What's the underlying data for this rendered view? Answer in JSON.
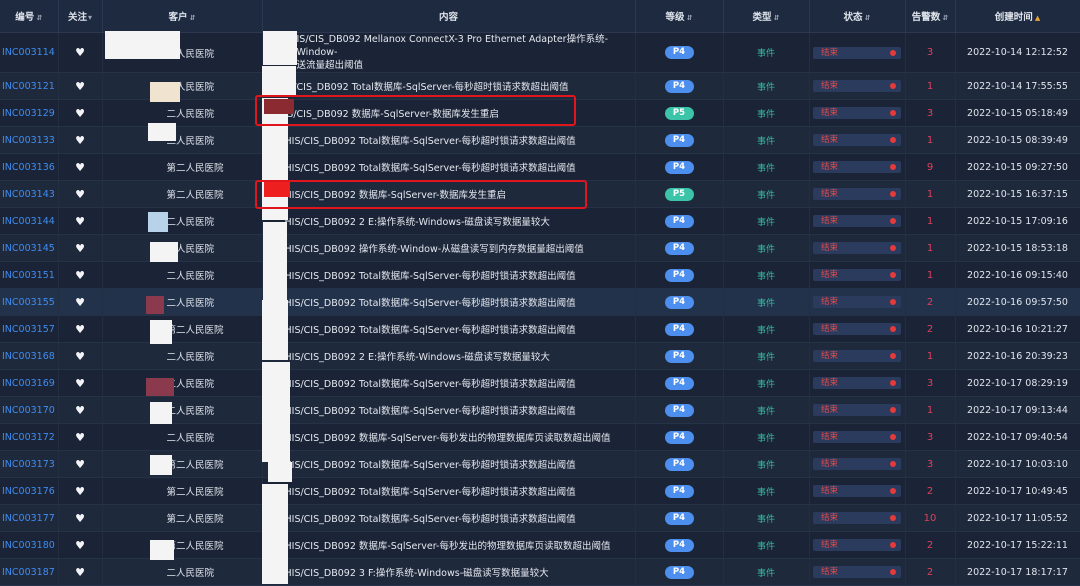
{
  "headers": {
    "code": "编号",
    "follow": "关注",
    "customer": "客户",
    "content": "内容",
    "level": "等级",
    "type": "类型",
    "status": "状态",
    "count": "告警数",
    "created": "创建时间"
  },
  "sort_icon": "⇵",
  "sort_asc_icon": "▲",
  "filter_icon": "▾",
  "heart_icon": "♥",
  "colors": {
    "P4": "#4d8fef",
    "P5": "#3cc4a9",
    "status_red": "#e24a4a",
    "code_blue": "#3f8cf0"
  },
  "rows": [
    {
      "code": "INC003114",
      "customer": "二人民医院",
      "content": "IS/CIS_DB092 Mellanox ConnectX-3 Pro Ethernet Adapter操作系统-Window-",
      "content2": "送流量超出阈值",
      "level": "P4",
      "type": "事件",
      "status": "结束",
      "count": "3",
      "time": "2022-10-14 12:12:52"
    },
    {
      "code": "INC003121",
      "customer": "二人民医院",
      "content": "IS/CIS_DB092 Total数据库-SqlServer-每秒超时锁请求数超出阈值",
      "level": "P4",
      "type": "事件",
      "status": "结束",
      "count": "1",
      "time": "2022-10-14 17:55:55"
    },
    {
      "code": "INC003129",
      "customer": "二人民医院",
      "content": "IS/CIS_DB092 数据库-SqlServer-数据库发生重启",
      "level": "P5",
      "type": "事件",
      "status": "结束",
      "count": "3",
      "time": "2022-10-15 05:18:49"
    },
    {
      "code": "INC003133",
      "customer": "二人民医院",
      "content": "HIS/CIS_DB092 Total数据库-SqlServer-每秒超时锁请求数超出阈值",
      "level": "P4",
      "type": "事件",
      "status": "结束",
      "count": "1",
      "time": "2022-10-15 08:39:49"
    },
    {
      "code": "INC003136",
      "customer": "第二人民医院",
      "content": "HIS/CIS_DB092 Total数据库-SqlServer-每秒超时锁请求数超出阈值",
      "level": "P4",
      "type": "事件",
      "status": "结束",
      "count": "9",
      "time": "2022-10-15 09:27:50"
    },
    {
      "code": "INC003143",
      "customer": "第二人民医院",
      "content": "HIS/CIS_DB092 数据库-SqlServer-数据库发生重启",
      "level": "P5",
      "type": "事件",
      "status": "结束",
      "count": "1",
      "time": "2022-10-15 16:37:15"
    },
    {
      "code": "INC003144",
      "customer": "二人民医院",
      "content": "HIS/CIS_DB092 2 E:操作系统-Windows-磁盘读写数据量较大",
      "level": "P4",
      "type": "事件",
      "status": "结束",
      "count": "1",
      "time": "2022-10-15 17:09:16"
    },
    {
      "code": "INC003145",
      "customer": "二人民医院",
      "content": "HIS/CIS_DB092 操作系统-Window-从磁盘读写到内存数据量超出阈值",
      "level": "P4",
      "type": "事件",
      "status": "结束",
      "count": "1",
      "time": "2022-10-15 18:53:18"
    },
    {
      "code": "INC003151",
      "customer": "二人民医院",
      "content": "HIS/CIS_DB092 Total数据库-SqlServer-每秒超时锁请求数超出阈值",
      "level": "P4",
      "type": "事件",
      "status": "结束",
      "count": "1",
      "time": "2022-10-16 09:15:40"
    },
    {
      "code": "INC003155",
      "customer": "二人民医院",
      "content": "HIS/CIS_DB092 Total数据库-SqlServer-每秒超时锁请求数超出阈值",
      "level": "P4",
      "type": "事件",
      "status": "结束",
      "count": "2",
      "time": "2022-10-16 09:57:50"
    },
    {
      "code": "INC003157",
      "customer": "第二人民医院",
      "content": "HIS/CIS_DB092 Total数据库-SqlServer-每秒超时锁请求数超出阈值",
      "level": "P4",
      "type": "事件",
      "status": "结束",
      "count": "2",
      "time": "2022-10-16 10:21:27"
    },
    {
      "code": "INC003168",
      "customer": "二人民医院",
      "content": "HIS/CIS_DB092 2 E:操作系统-Windows-磁盘读写数据量较大",
      "level": "P4",
      "type": "事件",
      "status": "结束",
      "count": "1",
      "time": "2022-10-16 20:39:23"
    },
    {
      "code": "INC003169",
      "customer": "二人民医院",
      "content": "HIS/CIS_DB092 Total数据库-SqlServer-每秒超时锁请求数超出阈值",
      "level": "P4",
      "type": "事件",
      "status": "结束",
      "count": "3",
      "time": "2022-10-17 08:29:19"
    },
    {
      "code": "INC003170",
      "customer": "二人民医院",
      "content": "HIS/CIS_DB092 Total数据库-SqlServer-每秒超时锁请求数超出阈值",
      "level": "P4",
      "type": "事件",
      "status": "结束",
      "count": "1",
      "time": "2022-10-17 09:13:44"
    },
    {
      "code": "INC003172",
      "customer": "二人民医院",
      "content": "HIS/CIS_DB092 数据库-SqlServer-每秒发出的物理数据库页读取数超出阈值",
      "level": "P4",
      "type": "事件",
      "status": "结束",
      "count": "3",
      "time": "2022-10-17 09:40:54"
    },
    {
      "code": "INC003173",
      "customer": "第二人民医院",
      "content": "HIS/CIS_DB092 Total数据库-SqlServer-每秒超时锁请求数超出阈值",
      "level": "P4",
      "type": "事件",
      "status": "结束",
      "count": "3",
      "time": "2022-10-17 10:03:10"
    },
    {
      "code": "INC003176",
      "customer": "第二人民医院",
      "content": "HIS/CIS_DB092 Total数据库-SqlServer-每秒超时锁请求数超出阈值",
      "level": "P4",
      "type": "事件",
      "status": "结束",
      "count": "2",
      "time": "2022-10-17 10:49:45"
    },
    {
      "code": "INC003177",
      "customer": "第二人民医院",
      "content": "HIS/CIS_DB092 Total数据库-SqlServer-每秒超时锁请求数超出阈值",
      "level": "P4",
      "type": "事件",
      "status": "结束",
      "count": "10",
      "time": "2022-10-17 11:05:52"
    },
    {
      "code": "INC003180",
      "customer": "第二人民医院",
      "content": "HIS/CIS_DB092 数据库-SqlServer-每秒发出的物理数据库页读取数超出阈值",
      "level": "P4",
      "type": "事件",
      "status": "结束",
      "count": "2",
      "time": "2022-10-17 15:22:11"
    },
    {
      "code": "INC003187",
      "customer": "二人民医院",
      "content": "HIS/CIS_DB092 3 F:操作系统-Windows-磁盘读写数据量较大",
      "level": "P4",
      "type": "事件",
      "status": "结束",
      "count": "2",
      "time": "2022-10-17 18:17:17"
    }
  ]
}
